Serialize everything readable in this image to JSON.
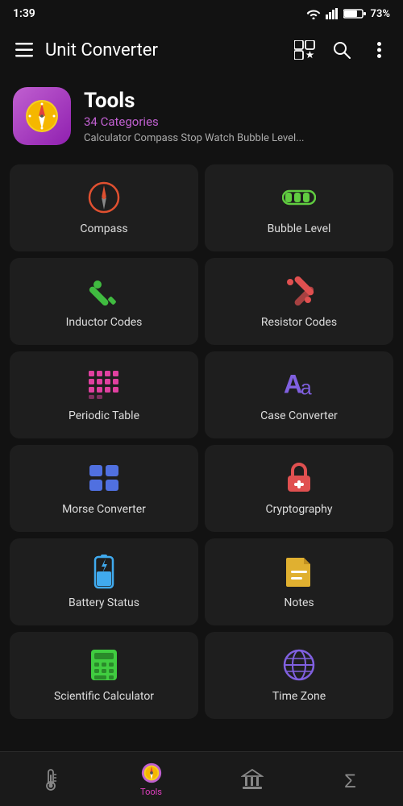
{
  "statusBar": {
    "time": "1:39",
    "battery": "73%"
  },
  "header": {
    "title": "Unit Converter",
    "sectionTitle": "Tools",
    "categories": "34 Categories",
    "subtitle": "Calculator Compass Stop Watch Bubble Level..."
  },
  "grid": {
    "items": [
      {
        "id": "compass",
        "label": "Compass",
        "iconColor": "#e05030"
      },
      {
        "id": "bubble-level",
        "label": "Bubble Level",
        "iconColor": "#60cc40"
      },
      {
        "id": "inductor-codes",
        "label": "Inductor Codes",
        "iconColor": "#40bb40"
      },
      {
        "id": "resistor-codes",
        "label": "Resistor Codes",
        "iconColor": "#e05050"
      },
      {
        "id": "periodic-table",
        "label": "Periodic Table",
        "iconColor": "#e040a0"
      },
      {
        "id": "case-converter",
        "label": "Case Converter",
        "iconColor": "#8060e0"
      },
      {
        "id": "morse-converter",
        "label": "Morse Converter",
        "iconColor": "#5070e0"
      },
      {
        "id": "cryptography",
        "label": "Cryptography",
        "iconColor": "#e05050"
      },
      {
        "id": "battery-status",
        "label": "Battery Status",
        "iconColor": "#40aaee"
      },
      {
        "id": "notes",
        "label": "Notes",
        "iconColor": "#e0b030"
      },
      {
        "id": "scientific-calculator",
        "label": "Scientific Calculator",
        "iconColor": "#40cc40"
      },
      {
        "id": "time-zone",
        "label": "Time Zone",
        "iconColor": "#8060e0"
      }
    ]
  },
  "bottomNav": {
    "items": [
      {
        "id": "thermometer",
        "label": "",
        "active": false
      },
      {
        "id": "tools",
        "label": "Tools",
        "active": true
      },
      {
        "id": "bank",
        "label": "",
        "active": false
      },
      {
        "id": "sigma",
        "label": "",
        "active": false
      }
    ]
  }
}
